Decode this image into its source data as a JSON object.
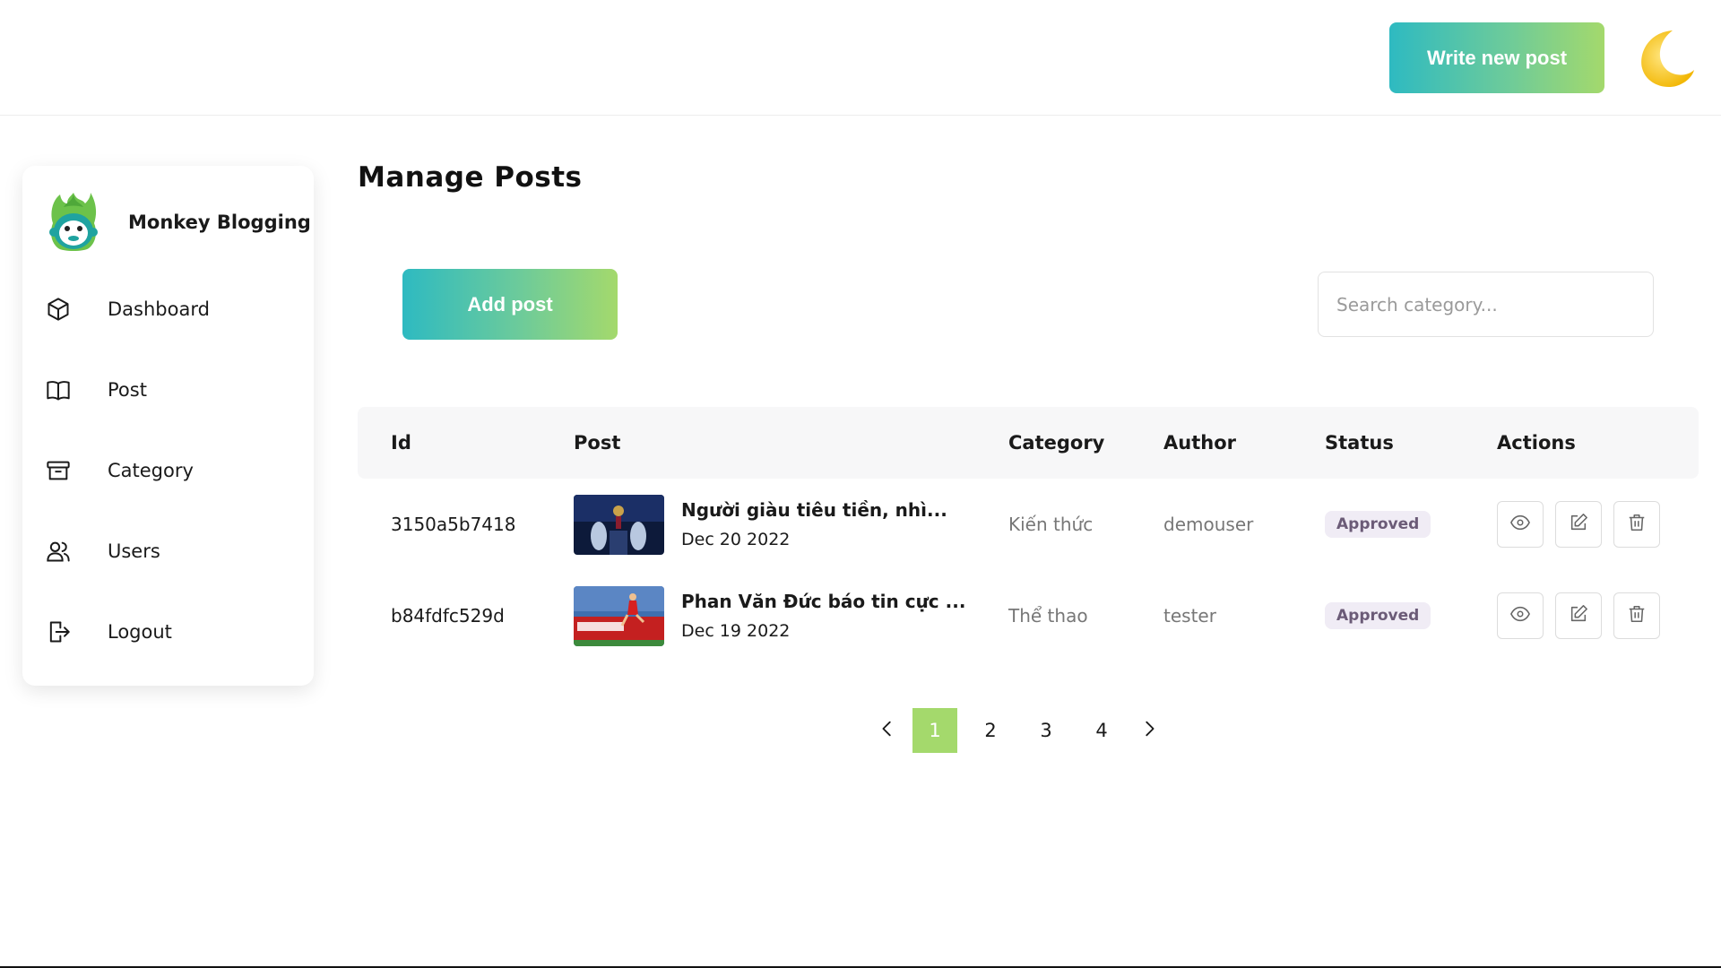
{
  "header": {
    "write_button": "Write new post",
    "theme_icon": "moon-icon"
  },
  "sidebar": {
    "brand": "Monkey Blogging",
    "logo_icon": "monkey-logo-icon",
    "items": [
      {
        "label": "Dashboard",
        "icon": "cube-icon"
      },
      {
        "label": "Post",
        "icon": "book-icon"
      },
      {
        "label": "Category",
        "icon": "archive-icon"
      },
      {
        "label": "Users",
        "icon": "users-icon"
      },
      {
        "label": "Logout",
        "icon": "logout-icon"
      }
    ]
  },
  "main": {
    "title": "Manage Posts",
    "add_button": "Add post",
    "search_placeholder": "Search category..."
  },
  "table": {
    "columns": [
      "Id",
      "Post",
      "Category",
      "Author",
      "Status",
      "Actions"
    ],
    "rows": [
      {
        "id": "3150a5b7418",
        "title": "Người giàu tiêu tiền, nhì...",
        "date": "Dec 20 2022",
        "category": "Kiến thức",
        "author": "demouser",
        "status": "Approved"
      },
      {
        "id": "b84fdfc529d",
        "title": "Phan Văn Đức báo tin cực ...",
        "date": "Dec 19 2022",
        "category": "Thể thao",
        "author": "tester",
        "status": "Approved"
      }
    ],
    "action_icons": [
      "eye-icon",
      "edit-icon",
      "trash-icon"
    ]
  },
  "pagination": {
    "pages": [
      "1",
      "2",
      "3",
      "4"
    ],
    "current": "1"
  },
  "colors": {
    "accent_start": "#2ebac1",
    "accent_end": "#a4d96c",
    "active_page": "#a4d96c"
  }
}
